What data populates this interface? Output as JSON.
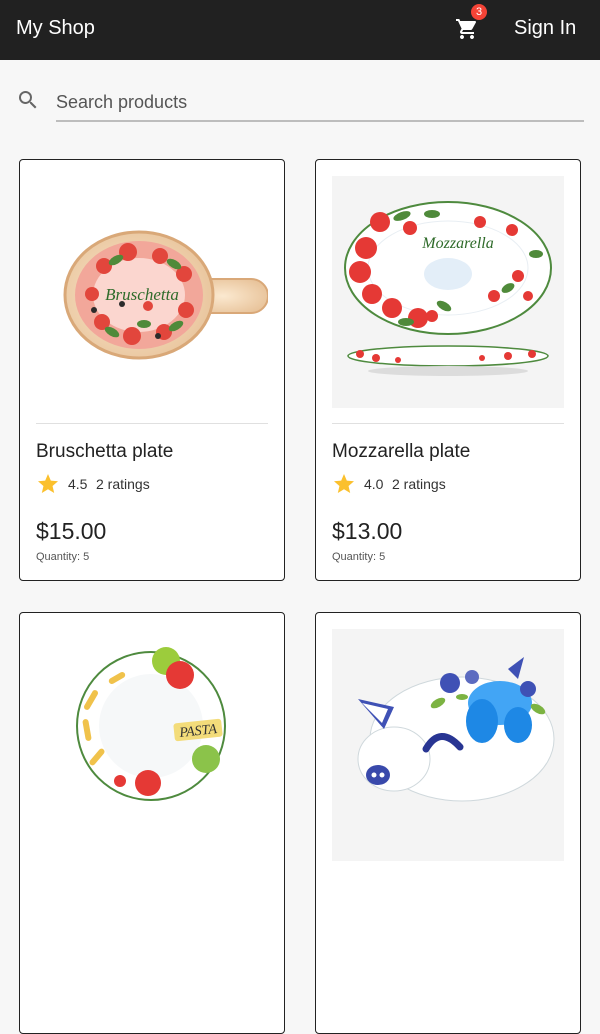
{
  "header": {
    "brand": "My Shop",
    "cart_count": "3",
    "sign_in": "Sign In"
  },
  "search": {
    "placeholder": "Search products",
    "value": ""
  },
  "products": [
    {
      "name": "Bruschetta plate",
      "rating": "4.5",
      "ratings_count": "2 ratings",
      "price": "$15.00",
      "quantity": "Quantity: 5",
      "image_text": "Bruschetta"
    },
    {
      "name": "Mozzarella plate",
      "rating": "4.0",
      "ratings_count": "2 ratings",
      "price": "$13.00",
      "quantity": "Quantity: 5",
      "image_text": "Mozzarella"
    },
    {
      "name": "",
      "image_text": "PASTA"
    },
    {
      "name": ""
    }
  ],
  "colors": {
    "appbar": "#212121",
    "badge": "#f44336",
    "star": "#fbc02d"
  },
  "icons": {
    "cart": "cart-icon",
    "search": "search-icon",
    "star": "star-icon"
  }
}
